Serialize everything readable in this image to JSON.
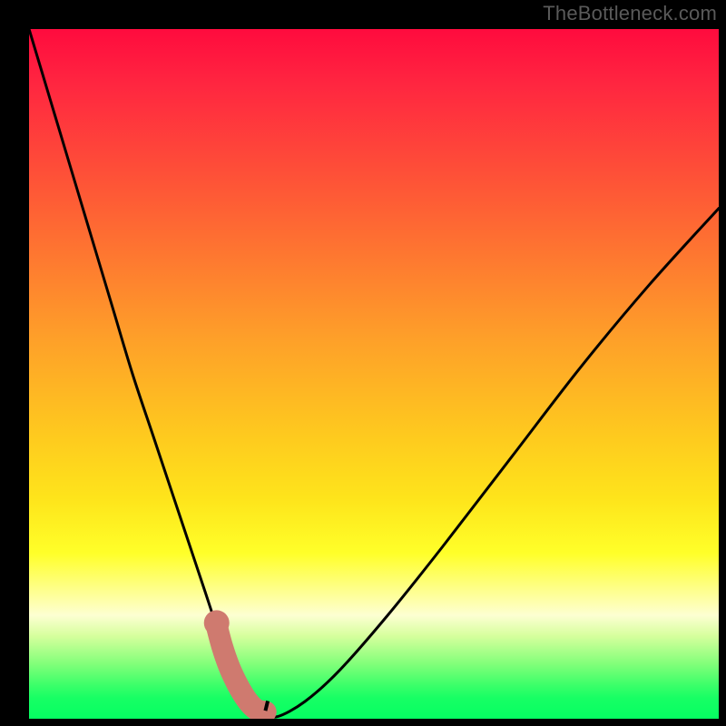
{
  "watermark": {
    "text": "TheBottleneck.com"
  },
  "colors": {
    "curve_stroke": "#000000",
    "marker_fill": "#cf7a6f",
    "background_black": "#000000"
  },
  "chart_data": {
    "type": "line",
    "title": "",
    "xlabel": "",
    "ylabel": "",
    "xlim": [
      0,
      100
    ],
    "ylim": [
      0,
      100
    ],
    "series": [
      {
        "name": "bottleneck-curve",
        "x": [
          0,
          3,
          6,
          9,
          12,
          15,
          18,
          21,
          24,
          25.5,
          27,
          28.5,
          30,
          31.5,
          33,
          34.5,
          36,
          40,
          45,
          52,
          60,
          70,
          80,
          90,
          100
        ],
        "y": [
          100,
          90,
          80,
          70,
          60,
          50,
          41,
          32,
          23,
          18.5,
          14,
          10,
          7,
          4.2,
          2.3,
          1.0,
          0.3,
          2.5,
          7,
          15,
          25,
          38,
          51,
          63,
          74
        ]
      }
    ],
    "markers": {
      "name": "highlight-region",
      "x": [
        27.2,
        28.0,
        29.0,
        30.0,
        31.0,
        32.0,
        33.0,
        34.3
      ],
      "y": [
        13.5,
        10.5,
        7.6,
        5.4,
        3.6,
        2.2,
        1.3,
        1.0
      ]
    },
    "notch_x": 34.3
  }
}
